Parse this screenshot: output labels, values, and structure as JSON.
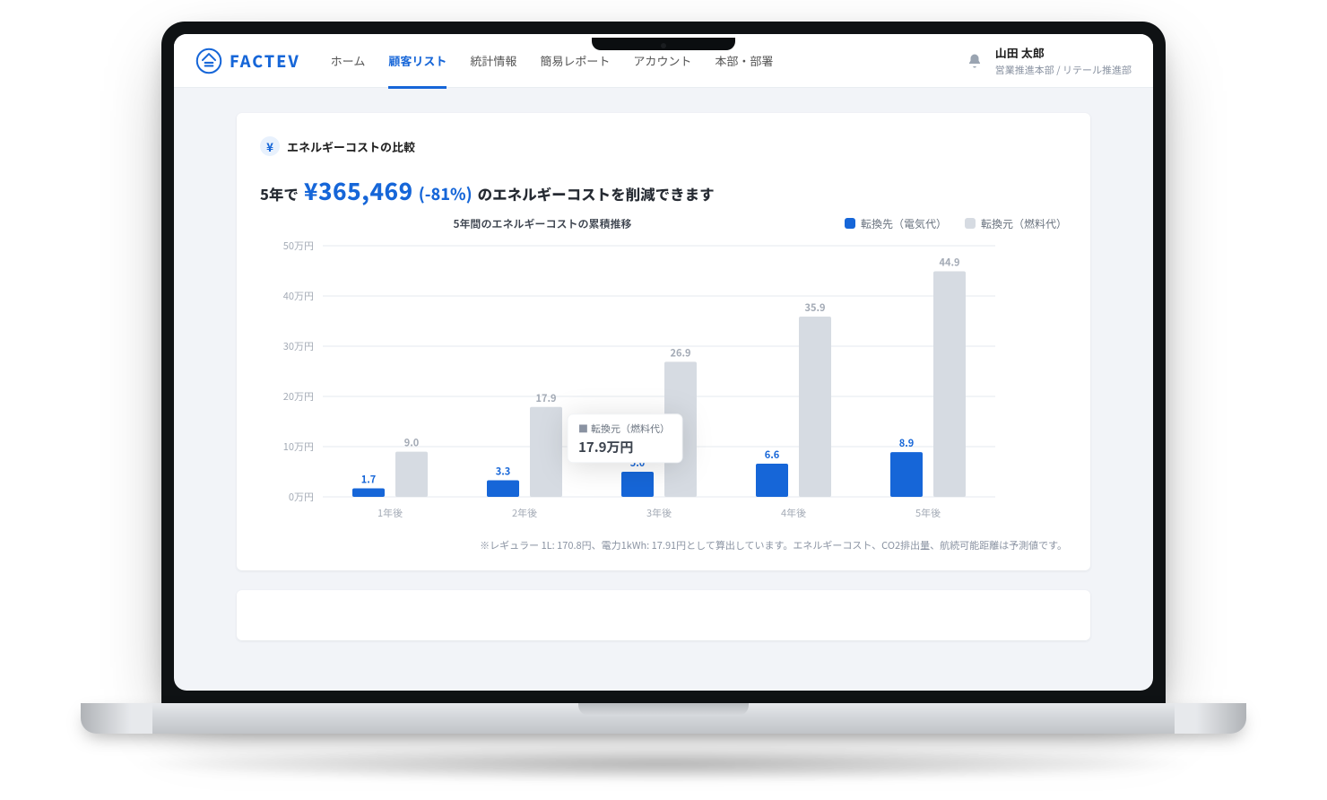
{
  "brand": "FACTEV",
  "nav": {
    "items": [
      {
        "label": "ホーム"
      },
      {
        "label": "顧客リスト",
        "active": true
      },
      {
        "label": "統計情報"
      },
      {
        "label": "簡易レポート"
      },
      {
        "label": "アカウント"
      },
      {
        "label": "本部・部署"
      }
    ]
  },
  "user": {
    "name": "山田 太郎",
    "dept": "営業推進本部 / リテール推進部"
  },
  "yen_symbol": "¥",
  "card_title": "エネルギーコストの比較",
  "summary": {
    "prefix": "5年で",
    "amount": "¥365,469",
    "pct": "(-81%)",
    "suffix": "のエネルギーコストを削減できます"
  },
  "tooltip": {
    "label": "転換元（燃料代）",
    "value": "17.9万円",
    "marker": "■"
  },
  "note": "※レギュラー 1L: 170.8円、電力1kWh: 17.91円として算出しています。エネルギーコスト、CO2排出量、航続可能距離は予測値です。",
  "chart_data": {
    "type": "bar",
    "title": "5年間のエネルギーコストの累積推移",
    "categories": [
      "1年後",
      "2年後",
      "3年後",
      "4年後",
      "5年後"
    ],
    "y_ticks": [
      "0万円",
      "10万円",
      "20万円",
      "30万円",
      "40万円",
      "50万円"
    ],
    "ylim": [
      0,
      50
    ],
    "legend": [
      {
        "name": "転換先（電気代）",
        "color": "#1666d8"
      },
      {
        "name": "転換元（燃料代）",
        "color": "#d6dbe2"
      }
    ],
    "series": [
      {
        "name": "転換先（電気代）",
        "values": [
          1.7,
          3.3,
          5.0,
          6.6,
          8.9
        ]
      },
      {
        "name": "転換元（燃料代）",
        "values": [
          9.0,
          17.9,
          26.9,
          35.9,
          44.9
        ]
      }
    ],
    "unit": "万円"
  }
}
